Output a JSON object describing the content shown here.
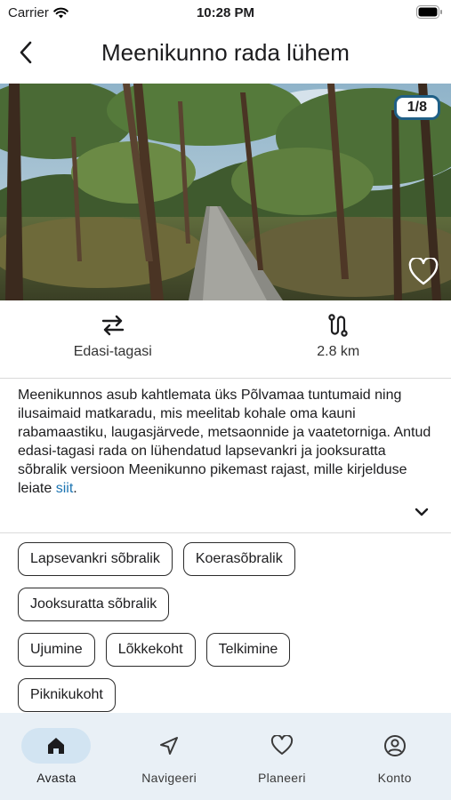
{
  "status_bar": {
    "carrier": "Carrier",
    "time": "10:28 PM"
  },
  "header": {
    "title": "Meenikunno rada lühem",
    "back_icon": "chevron-left-icon"
  },
  "hero": {
    "image_counter": "1/8",
    "favorite_icon": "heart-outline-icon"
  },
  "stats": [
    {
      "icon": "arrows-left-right-icon",
      "label": "Edasi-tagasi"
    },
    {
      "icon": "route-icon",
      "label": "2.8 km"
    }
  ],
  "description": {
    "text": "Meenikunnos asub kahtlemata üks Põlvamaa tuntumaid ning ilusaimaid matkaradu, mis meelitab kohale oma kauni rabamaastiku, laugasjärvede, metsaonnide ja vaatetorniga. Antud edasi-tagasi rada on lühendatud lapsevankri ja jooksuratta sõbralik versioon Meenikunno pikemast rajast, mille kirjelduse leiate ",
    "link_text": "siit",
    "after_link": ".",
    "expand_icon": "chevron-down-icon"
  },
  "tags": {
    "row1": [
      "Lapsevankri sõbralik",
      "Koerasõbralik"
    ],
    "row2": [
      "Jooksuratta sõbralik"
    ],
    "row3": [
      "Ujumine",
      "Lõkkekoht",
      "Telkimine"
    ],
    "row4": [
      "Piknikukoht"
    ]
  },
  "bottom_nav": [
    {
      "label": "Avasta",
      "icon": "home-icon",
      "active": true
    },
    {
      "label": "Navigeeri",
      "icon": "navigation-arrow-icon",
      "active": false
    },
    {
      "label": "Planeeri",
      "icon": "heart-icon",
      "active": false
    },
    {
      "label": "Konto",
      "icon": "account-icon",
      "active": false
    }
  ],
  "colors": {
    "accent": "#1f5f86",
    "link": "#1c74b2",
    "nav_bg": "#e9f0f6",
    "nav_active": "#d2e4f2"
  }
}
